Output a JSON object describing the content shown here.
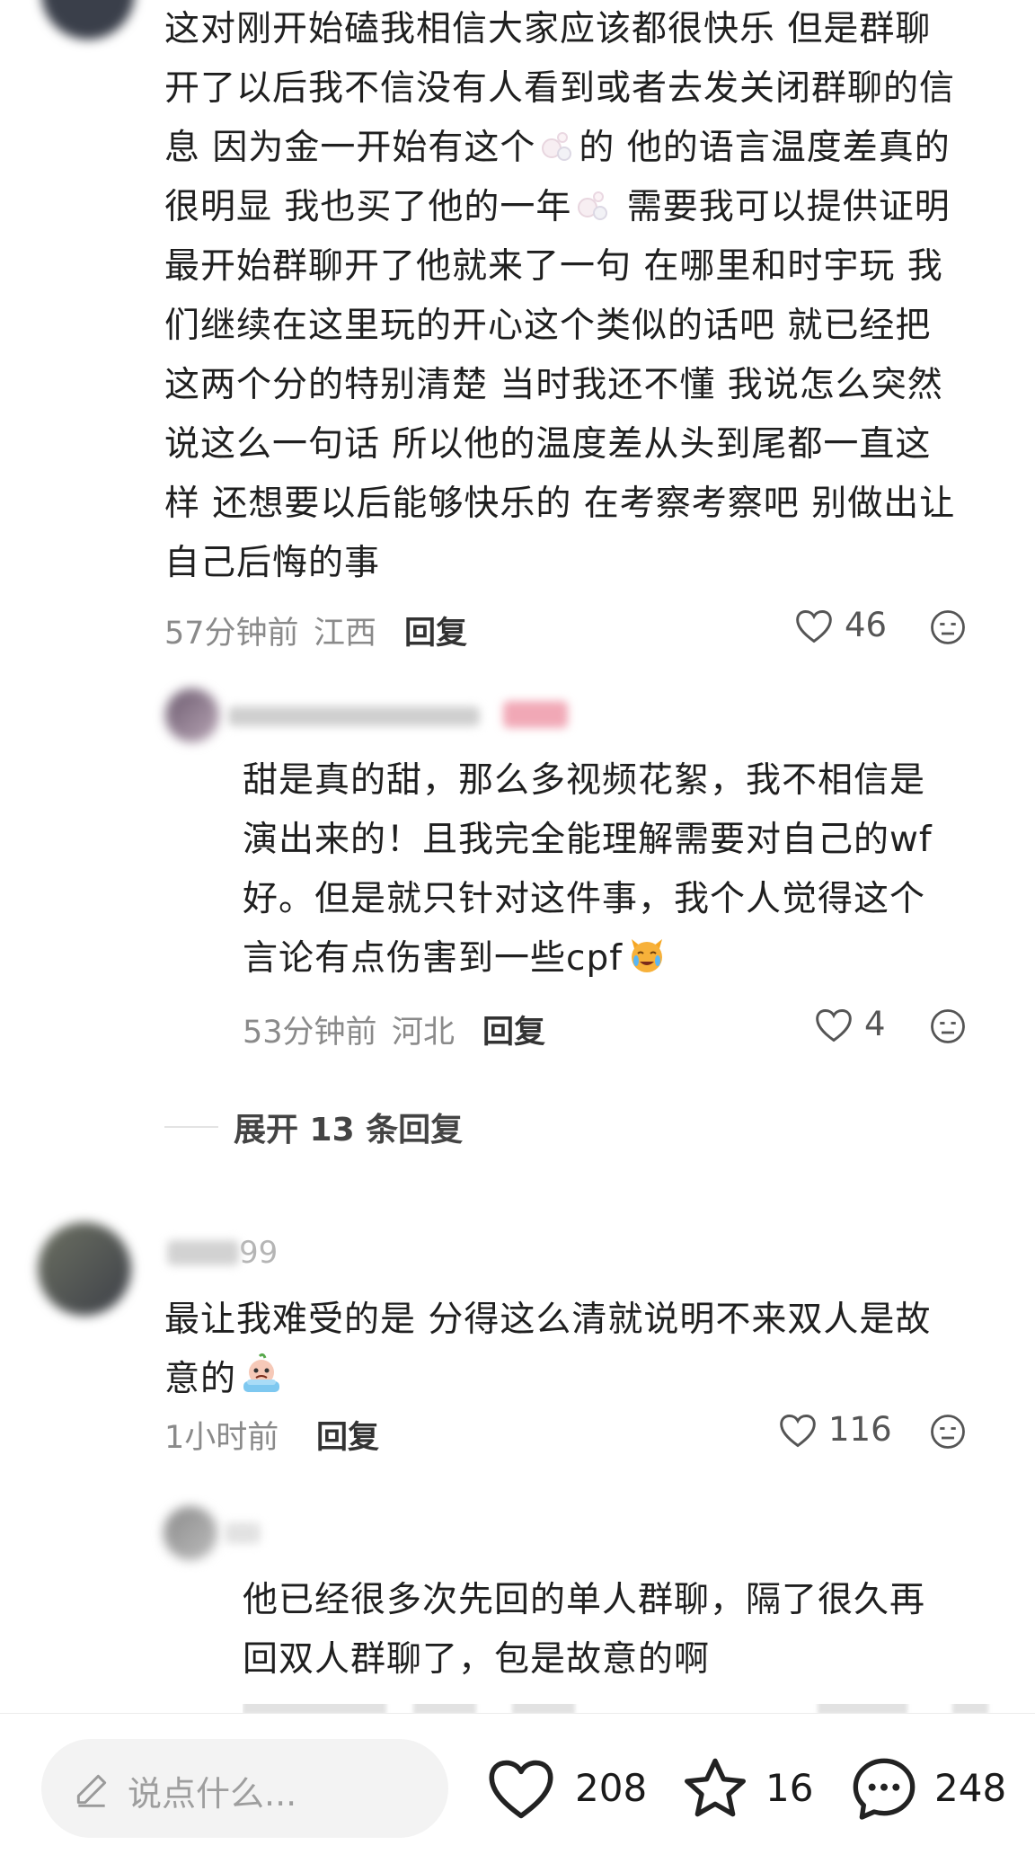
{
  "comment1": {
    "text": "这对刚开始磕我相信大家应该都很快乐 但是群聊开了以后我不信没有人看到或者去发关闭群聊的信息 因为金一开始有这个[emoji]的 他的语言温度差真的很明显 我也买了他的一年[emoji] 需要我可以提供证明最开始群聊开了他就来了一句 在哪里和时宇玩 我们继续在这里玩的开心这个类似的话吧 就已经把这两个分的特别清楚 当时我还不懂 我说怎么突然说这么一句话 所以他的温度差从头到尾都一直这样 还想要以后能够快乐的 在考察考察吧 别做出让自己后悔的事",
    "lines": [
      "这对刚开始磕我相信大家应该都很快乐 但是群聊",
      "开了以后我不信没有人看到或者去发关闭群聊的信",
      "息 因为金一开始有这个",
      "的 他的语言温度差真的",
      "很明显 我也买了他的一年",
      " 需要我可以提供证明",
      "最开始群聊开了他就来了一句 在哪里和时宇玩 我",
      "们继续在这里玩的开心这个类似的话吧 就已经把",
      "这两个分的特别清楚 当时我还不懂 我说怎么突然",
      "说这么一句话 所以他的温度差从头到尾都一直这",
      "样 还想要以后能够快乐的 在考察考察吧 别做出让",
      "自己后悔的事"
    ],
    "time": "57分钟前",
    "location": "江西",
    "reply_label": "回复",
    "likes": "46"
  },
  "reply1": {
    "lines": [
      "甜是真的甜，那么多视频花絮，我不相信是",
      "演出来的！且我完全能理解需要对自己的wf",
      "好。但是就只针对这件事，我个人觉得这个",
      "言论有点伤害到一些cpf"
    ],
    "time": "53分钟前",
    "location": "河北",
    "reply_label": "回复",
    "likes": "4"
  },
  "expand_label": "展开 13 条回复",
  "comment2": {
    "username_visible": "99",
    "lines": [
      "最让我难受的是 分得这么清就说明不来双人是故",
      "意的"
    ],
    "time": "1小时前",
    "reply_label": "回复",
    "likes": "116"
  },
  "reply2": {
    "lines": [
      "他已经很多次先回的单人群聊，隔了很久再",
      "回双人群聊了，包是故意的啊"
    ]
  },
  "bottom": {
    "input_placeholder": "说点什么...",
    "likes": "208",
    "stars": "16",
    "comments": "248"
  },
  "colors": {
    "text": "#1f1f1f",
    "meta": "#8a8a8a",
    "icon": "#2a2a2a"
  }
}
